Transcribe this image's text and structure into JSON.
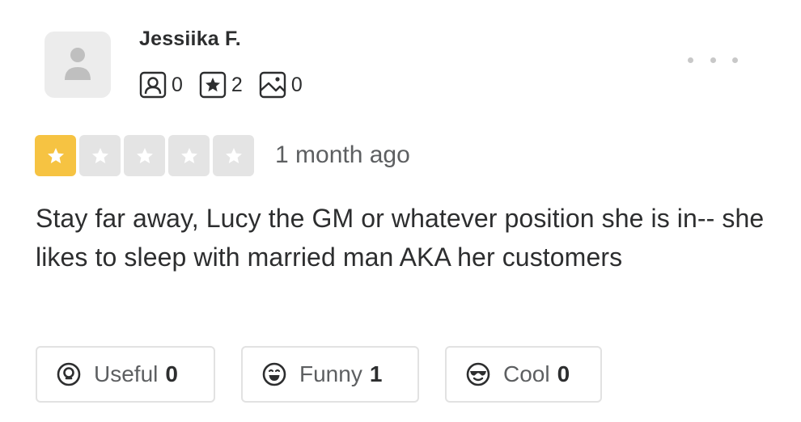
{
  "user": {
    "name": "Jessiika F.",
    "stats": {
      "friends": "0",
      "reviews": "2",
      "photos": "0"
    },
    "icons": {
      "avatar": "default-user-avatar",
      "friends": "friends-icon",
      "reviews": "review-star-icon",
      "photos": "photo-icon"
    }
  },
  "menu": {
    "icon": "more-options-icon"
  },
  "review": {
    "rating": 1,
    "rating_max": 5,
    "date": "1 month ago",
    "text": "Stay far away, Lucy the GM or whatever position she is in-- she likes to sleep with married man AKA her customers"
  },
  "reactions": {
    "useful": {
      "label": "Useful",
      "count": "0",
      "icon": "lightbulb-icon"
    },
    "funny": {
      "label": "Funny",
      "count": "1",
      "icon": "laughing-face-icon"
    },
    "cool": {
      "label": "Cool",
      "count": "0",
      "icon": "sunglasses-face-icon"
    }
  },
  "colors": {
    "star_active": "#f6c342",
    "star_inactive": "#e4e4e4",
    "text": "#2d2e2f",
    "muted": "#5d5f61"
  }
}
